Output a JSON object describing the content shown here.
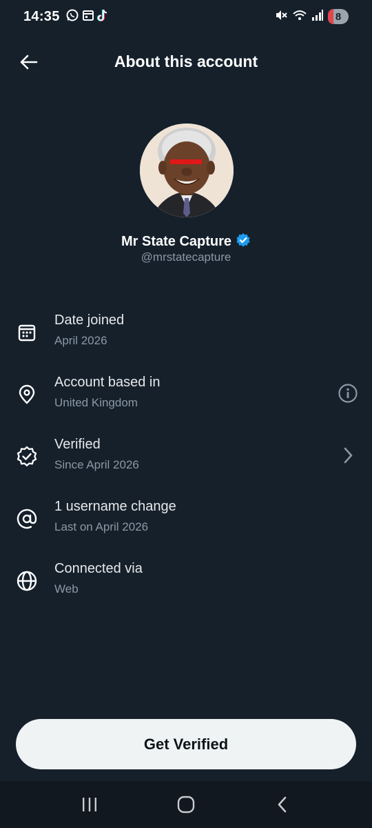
{
  "status_bar": {
    "time": "14:35",
    "left_icons": [
      "whatsapp-icon",
      "calendar-icon",
      "tiktok-icon"
    ],
    "right_icons": [
      "mute-icon",
      "wifi-icon",
      "signal-icon"
    ],
    "battery_level": "8"
  },
  "header": {
    "title": "About this account"
  },
  "profile": {
    "display_name": "Mr State Capture",
    "username": "@mrstatecapture",
    "verified": true
  },
  "info_rows": [
    {
      "icon": "calendar-icon",
      "title": "Date joined",
      "subtitle": "April 2026",
      "action": null
    },
    {
      "icon": "location-pin-icon",
      "title": "Account based in",
      "subtitle": "United Kingdom",
      "action": "info-icon"
    },
    {
      "icon": "verified-badge-icon",
      "title": "Verified",
      "subtitle": "Since April 2026",
      "action": "chevron-right-icon"
    },
    {
      "icon": "at-sign-icon",
      "title": "1 username change",
      "subtitle": "Last on April 2026",
      "action": null
    },
    {
      "icon": "globe-icon",
      "title": "Connected via",
      "subtitle": "Web",
      "action": null
    }
  ],
  "cta": {
    "label": "Get Verified"
  },
  "colors": {
    "background": "#15202b",
    "text_primary": "#e7e9ea",
    "text_secondary": "#8b98a5",
    "verified_blue": "#1d9bf0",
    "button_bg": "#eff3f4"
  }
}
